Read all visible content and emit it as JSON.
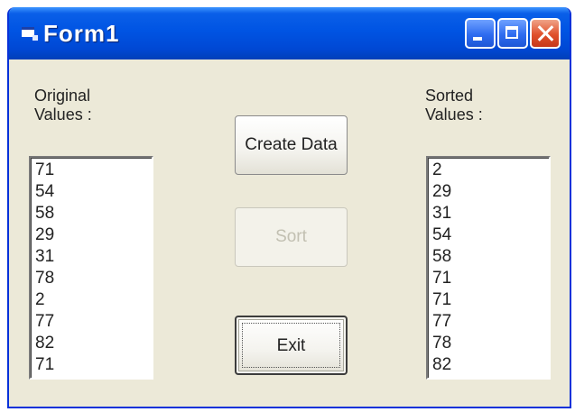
{
  "window": {
    "title": "Form1"
  },
  "labels": {
    "original_line1": "Original",
    "original_line2": "Values :",
    "sorted_line1": "Sorted",
    "sorted_line2": "Values :"
  },
  "original_values": [
    "71",
    "54",
    "58",
    "29",
    "31",
    "78",
    "2",
    "77",
    "82",
    "71"
  ],
  "sorted_values": [
    "2",
    "29",
    "31",
    "54",
    "58",
    "71",
    "71",
    "77",
    "78",
    "82"
  ],
  "buttons": {
    "create_data": "Create Data",
    "sort": "Sort",
    "exit": "Exit"
  },
  "state": {
    "sort_enabled": false,
    "focused_button": "exit"
  },
  "colors": {
    "titlebar": "#0054e3",
    "window_face": "#ece9d8",
    "close_button": "#e0502b"
  },
  "icons": {
    "app": "form-window-icon",
    "minimize": "minimize-icon",
    "maximize": "maximize-icon",
    "close": "close-icon"
  }
}
